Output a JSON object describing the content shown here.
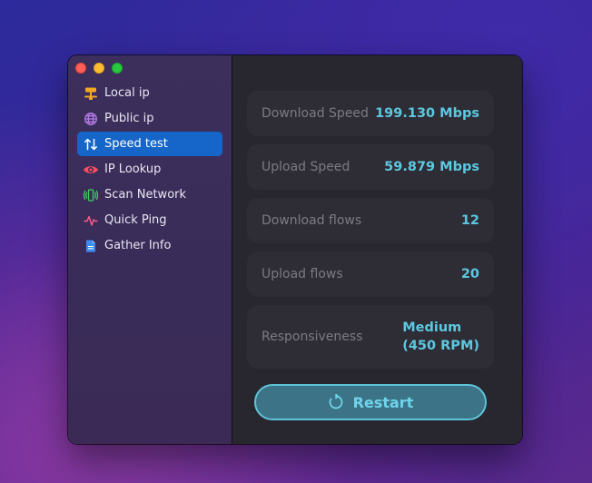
{
  "window": {
    "controls": [
      "close",
      "minimize",
      "zoom"
    ]
  },
  "sidebar": {
    "items": [
      {
        "label": "Local ip",
        "icon": "local-network-icon",
        "color": "#f5a623",
        "selected": false
      },
      {
        "label": "Public ip",
        "icon": "globe-icon",
        "color": "#b57be8",
        "selected": false
      },
      {
        "label": "Speed test",
        "icon": "up-down-arrows-icon",
        "color": "#ffffff",
        "selected": true
      },
      {
        "label": "IP Lookup",
        "icon": "eye-icon",
        "color": "#ff4d5e",
        "selected": false
      },
      {
        "label": "Scan Network",
        "icon": "phone-signal-icon",
        "color": "#3ccf5c",
        "selected": false
      },
      {
        "label": "Quick Ping",
        "icon": "waveform-icon",
        "color": "#ff5a8a",
        "selected": false
      },
      {
        "label": "Gather Info",
        "icon": "document-icon",
        "color": "#3b8df5",
        "selected": false
      }
    ]
  },
  "main": {
    "stats": [
      {
        "label": "Download Speed",
        "value": "199.130 Mbps"
      },
      {
        "label": "Upload Speed",
        "value": "59.879 Mbps"
      },
      {
        "label": "Download flows",
        "value": "12"
      },
      {
        "label": "Upload flows",
        "value": "20"
      },
      {
        "label": "Responsiveness",
        "value_line1": "Medium",
        "value_line2": "(450 RPM)"
      }
    ],
    "restart_label": "Restart",
    "restart_icon": "refresh-icon"
  },
  "colors": {
    "accent_value": "#5cc8e0",
    "selection": "#1566c8",
    "button_fill": "#3d7386",
    "button_border": "#5ec4d8"
  }
}
